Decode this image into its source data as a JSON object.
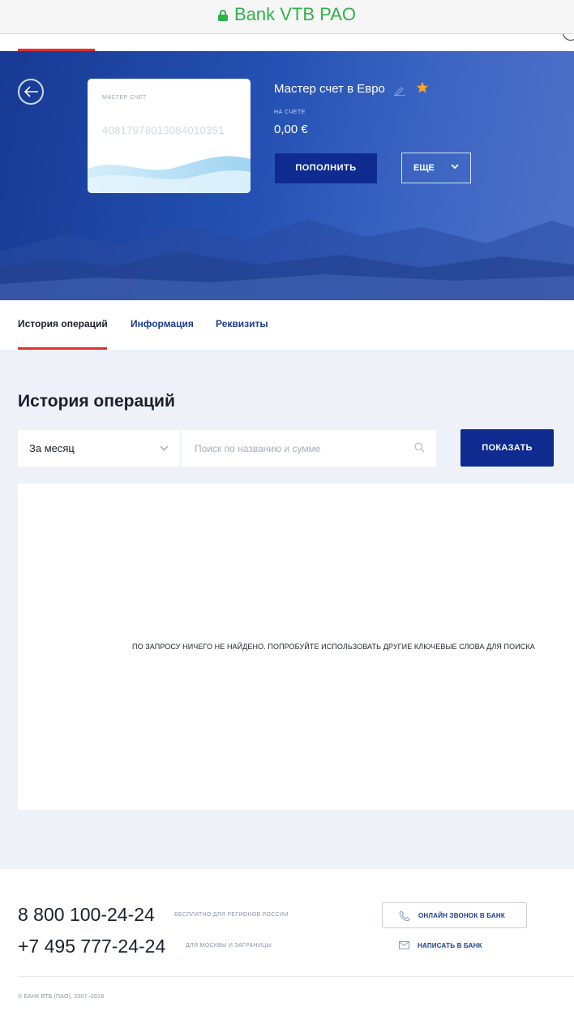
{
  "browser": {
    "url_label": "Bank VTB PAO"
  },
  "hero": {
    "card_label": "МАСТЕР СЧЕТ",
    "card_number": "40817978013084010351",
    "account_title": "Мастер счет в Евро",
    "balance_label": "НА СЧЕТЕ",
    "balance": "0,00 €",
    "topup_label": "ПОПОЛНИТЬ",
    "more_label": "ЕЩЕ"
  },
  "tabs": [
    {
      "label": "История операций"
    },
    {
      "label": "Информация"
    },
    {
      "label": "Реквизиты"
    }
  ],
  "history": {
    "title": "История операций",
    "period_value": "За месяц",
    "search_placeholder": "Поиск по названию и сумме",
    "show_label": "ПОКАЗАТЬ",
    "empty_message": "ПО ЗАПРОСУ НИЧЕГО НЕ НАЙДЕНО. ПОПРОБУЙТЕ ИСПОЛЬЗОВАТЬ ДРУГИЕ КЛЮЧЕВЫЕ СЛОВА ДЛЯ ПОИСКА"
  },
  "footer": {
    "phone1": "8 800 100-24-24",
    "phone1_note": "БЕСПЛАТНО ДЛЯ РЕГИОНОВ РОССИИ",
    "phone2": "+7 495 777-24-24",
    "phone2_note": "ДЛЯ МОСКВЫ И ЗАГРАНИЦЫ",
    "callback_label": "ОНЛАЙН ЗВОНОК В БАНК",
    "write_label": "НАПИСАТЬ В БАНК",
    "copyright": "© БАНК ВТБ (ПАО), 2007–2018"
  },
  "icons": {
    "lock": "lock-icon",
    "back": "arrow-left-icon",
    "edit": "pencil-icon",
    "favorite": "star-icon",
    "dropdown": "chevron-down-icon",
    "search": "search-icon",
    "phone": "phone-icon",
    "mail": "envelope-icon"
  },
  "colors": {
    "accent_red": "#e4302f",
    "primary_blue": "#0f2b8f",
    "link_blue": "#1c3c8f",
    "star": "#f5a623",
    "url_green": "#2fb24a"
  }
}
